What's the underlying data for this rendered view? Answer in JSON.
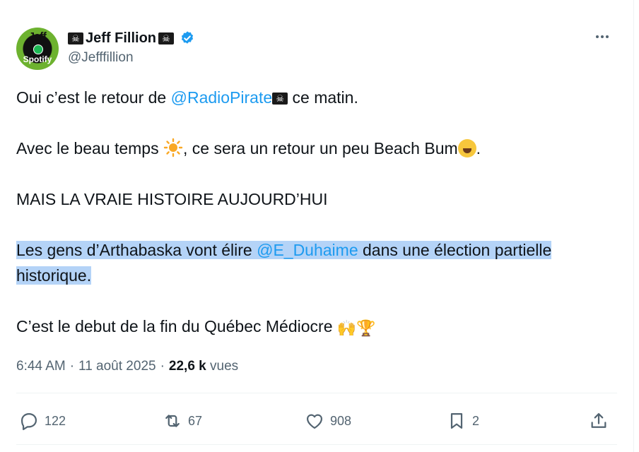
{
  "header": {
    "avatar_line1": "Jeff",
    "avatar_line2": "Spotify",
    "flag_glyph": "☠",
    "display_name": "Jeff Fillion",
    "handle": "@Jefffillion"
  },
  "tweet": {
    "line1_before": "Oui c’est le retour de ",
    "line1_mention": "@RadioPirate",
    "line1_after": " ce matin.",
    "line2_before": "Avec le beau temps ",
    "line2_middle": ", ce sera un retour un peu Beach Bum",
    "line2_after": ".",
    "line3": "MAIS LA VRAIE HISTOIRE AUJOURD’HUI",
    "line4_before": "Les gens d’Arthabaska vont élire ",
    "line4_mention": "@E_Duhaime",
    "line4_after": " dans une élection partielle",
    "line5": "historique.",
    "line6": "C’est le debut de la fin du Québec Médiocre "
  },
  "meta": {
    "time": "6:44 AM",
    "separator": "·",
    "date": "11 août 2025",
    "views_count": "22,6 k",
    "views_label": "vues"
  },
  "actions": {
    "replies": "122",
    "reposts": "67",
    "likes": "908",
    "bookmarks": "2"
  },
  "colors": {
    "link": "#1d9bf0",
    "highlight": "#b4d3f7",
    "secondary_text": "#536471",
    "verified": "#1d9bf0"
  }
}
